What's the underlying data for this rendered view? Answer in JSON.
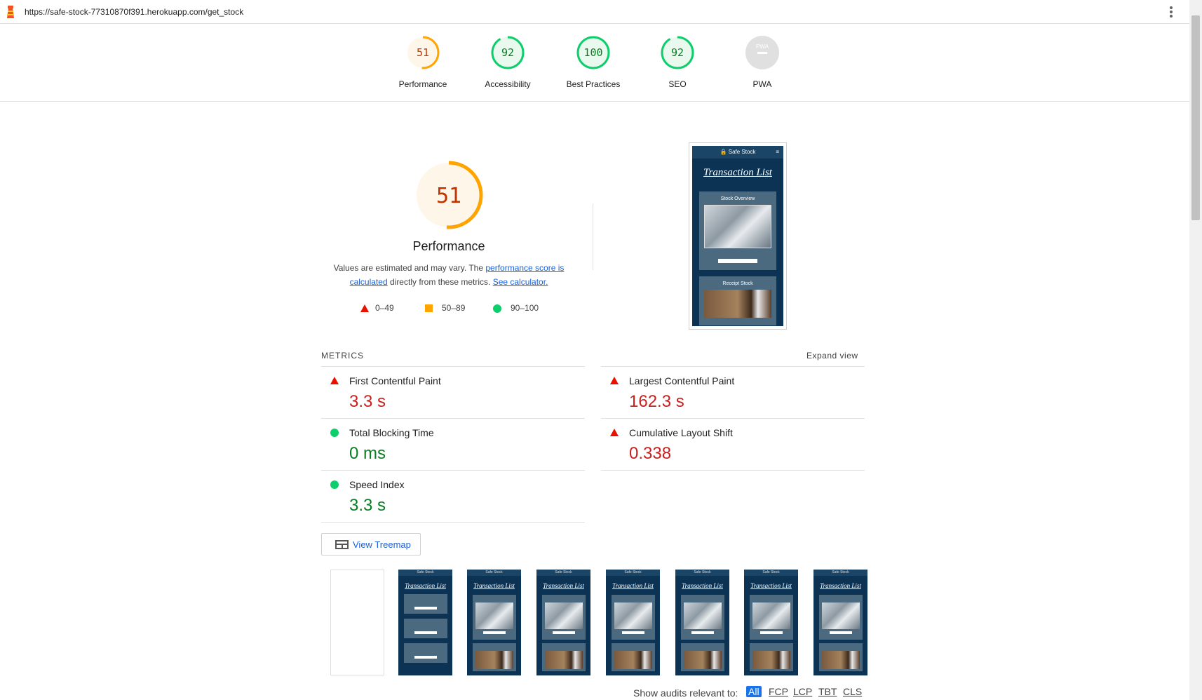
{
  "browser": {
    "url": "https://safe-stock-77310870f391.herokuapp.com/get_stock",
    "logo_icon": "lighthouse-icon",
    "menu_icon": "kebab-menu-icon"
  },
  "colors": {
    "fail": "#eb0f00",
    "average": "#ffa400",
    "pass": "#0cce6b",
    "link": "#1a5fd6"
  },
  "category_gauges": [
    {
      "score": "51",
      "value": 51,
      "label": "Performance",
      "status": "average"
    },
    {
      "score": "92",
      "value": 92,
      "label": "Accessibility",
      "status": "pass"
    },
    {
      "score": "100",
      "value": 100,
      "label": "Best Practices",
      "status": "pass"
    },
    {
      "score": "92",
      "value": 92,
      "label": "SEO",
      "status": "pass"
    },
    {
      "score": "",
      "badge_text": "PWA",
      "value": 0,
      "label": "PWA",
      "status": "na"
    }
  ],
  "performance": {
    "score": "51",
    "value": 51,
    "title": "Performance",
    "desc_prefix": "Values are estimated and may vary. The ",
    "desc_link1": "performance score is calculated",
    "desc_middle": " directly from these metrics. ",
    "desc_link2": "See calculator.",
    "legend": [
      {
        "icon": "triangle-icon",
        "range": "0–49"
      },
      {
        "icon": "square-icon",
        "range": "50–89"
      },
      {
        "icon": "circle-icon",
        "range": "90–100"
      }
    ]
  },
  "final_screenshot": {
    "nav": "🔒 Safe Stock",
    "menu": "≡",
    "title": "Transaction List",
    "card1_title": "Stock Overview",
    "card2_title": "Receipt Stock"
  },
  "metrics": {
    "heading": "METRICS",
    "expand": "Expand view",
    "items": [
      {
        "label": "First Contentful Paint",
        "value": "3.3 s",
        "status": "fail"
      },
      {
        "label": "Largest Contentful Paint",
        "value": "162.3 s",
        "status": "fail"
      },
      {
        "label": "Total Blocking Time",
        "value": "0 ms",
        "status": "pass"
      },
      {
        "label": "Cumulative Layout Shift",
        "value": "0.338",
        "status": "fail"
      },
      {
        "label": "Speed Index",
        "value": "3.3 s",
        "status": "pass"
      }
    ]
  },
  "treemap": {
    "label": "View Treemap",
    "icon": "treemap-icon"
  },
  "filmstrip": {
    "nav": "Safe Stock",
    "title": "Transaction List"
  },
  "audit_filter": {
    "label": "Show audits relevant to:",
    "options": [
      "All",
      "FCP",
      "LCP",
      "TBT",
      "CLS"
    ],
    "selected": "All"
  }
}
